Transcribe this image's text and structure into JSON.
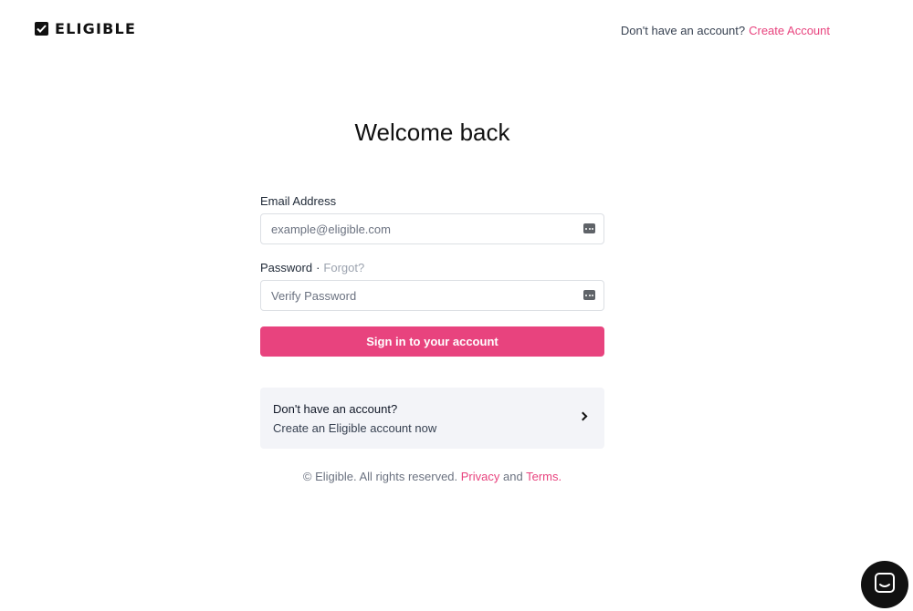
{
  "brand": {
    "name": "ELIGIBLE",
    "icon": "checkbox-icon"
  },
  "header": {
    "prompt": "Don't have an account?",
    "cta": "Create Account"
  },
  "form": {
    "title": "Welcome back",
    "email": {
      "label": "Email Address",
      "placeholder": "example@eligible.com",
      "value": ""
    },
    "password": {
      "label": "Password",
      "separator": "·",
      "forgot": "Forgot?",
      "placeholder": "Verify Password",
      "value": ""
    },
    "submit": "Sign in to your account"
  },
  "signup_card": {
    "question": "Don't have an account?",
    "subtitle": "Create an Eligible account now"
  },
  "footer": {
    "text": "© Eligible. All rights reserved.",
    "privacy": "Privacy",
    "and": "and",
    "terms": "Terms",
    "period": "."
  },
  "colors": {
    "accent": "#e8437e",
    "card_bg": "#f3f4f8"
  },
  "chat": {
    "icon": "chat-icon"
  }
}
